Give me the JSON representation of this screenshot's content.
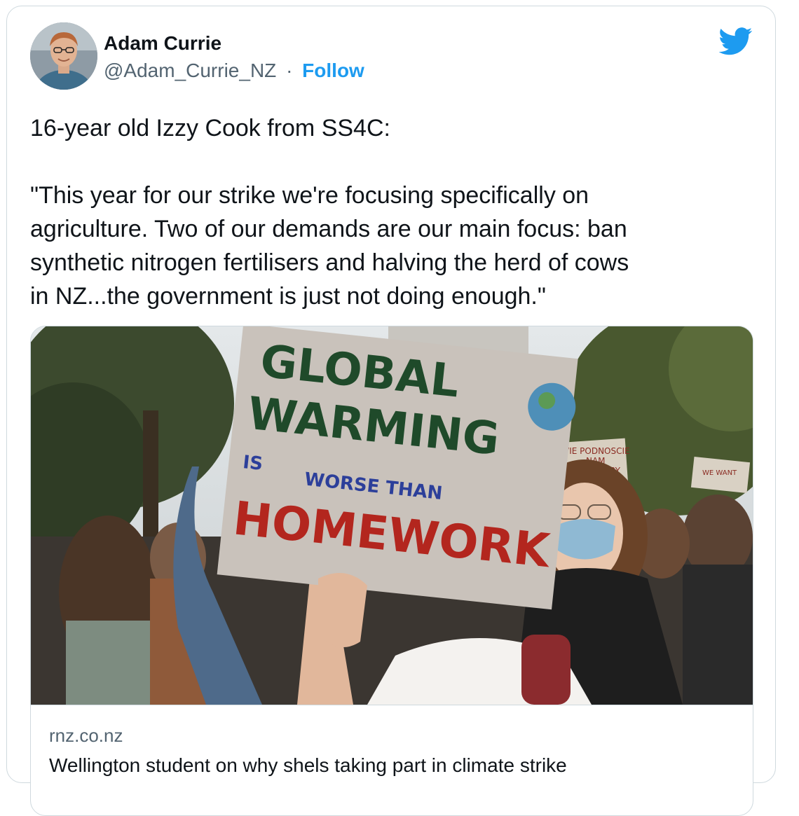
{
  "author": {
    "name": "Adam Currie",
    "handle": "@Adam_Currie_NZ",
    "separator": "·",
    "follow_label": "Follow"
  },
  "brand": {
    "icon": "twitter-bird-icon",
    "color": "#1d9bf0"
  },
  "tweet": {
    "text": "16-year old Izzy Cook from SS4C:\n\n\"This year for our strike we're focusing specifically on\nagriculture. Two of our demands are our main focus: ban\nsynthetic nitrogen fertilisers and halving the herd of cows\nin NZ...the government is just not doing enough.\""
  },
  "link_card": {
    "domain": "rnz.co.nz",
    "headline": "Wellington student on why shels taking part in climate strike",
    "image": {
      "sign_line1": "GLOBAL",
      "sign_line2": "WARMING",
      "sign_line3a": "IS",
      "sign_line3b": "WORSE THAN",
      "sign_line4": "HOMEWORK",
      "bg_sign1_line1": "VIE PODNOSCIE",
      "bg_sign1_line2": "NAM",
      "bg_sign1_line3": "TURY",
      "bg_sign2_line1": "WE WANT"
    }
  },
  "colors": {
    "text_primary": "#0f1419",
    "text_secondary": "#536471",
    "link": "#1d9bf0",
    "border": "#cfd9de"
  }
}
